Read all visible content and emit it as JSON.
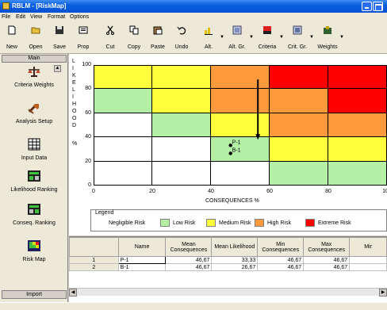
{
  "window": {
    "title": "RBLM - [RiskMap]"
  },
  "menu": [
    "File",
    "Edit",
    "View",
    "Format",
    "Options"
  ],
  "toolbar": [
    {
      "label": "New",
      "icon": "new-document-icon"
    },
    {
      "label": "Open",
      "icon": "open-folder-icon"
    },
    {
      "label": "Save",
      "icon": "save-disk-icon"
    },
    {
      "label": "Prop",
      "icon": "properties-icon"
    },
    {
      "label": "Cut",
      "icon": "scissors-icon"
    },
    {
      "label": "Copy",
      "icon": "copy-icon"
    },
    {
      "label": "Paste",
      "icon": "paste-icon"
    },
    {
      "label": "Undo",
      "icon": "undo-icon"
    },
    {
      "label": "Alt.",
      "icon": "alternatives-icon"
    },
    {
      "label": "Alt. Gr.",
      "icon": "alternative-groups-icon"
    },
    {
      "label": "Criteria",
      "icon": "criteria-icon"
    },
    {
      "label": "Crit. Gr.",
      "icon": "criteria-groups-icon"
    },
    {
      "label": "Weights",
      "icon": "weights-icon"
    }
  ],
  "sidebar": {
    "header": "Main",
    "footer": "Import",
    "items": [
      {
        "label": "Criteria Weights",
        "icon": "scales-icon"
      },
      {
        "label": "Analysis Setup",
        "icon": "tools-icon"
      },
      {
        "label": "Input Data",
        "icon": "data-grid-icon"
      },
      {
        "label": "Likelihood Ranking",
        "icon": "likelihood-ranking-icon"
      },
      {
        "label": "Conseq. Ranking",
        "icon": "consequence-ranking-icon"
      },
      {
        "label": "Risk Map",
        "icon": "risk-map-icon"
      }
    ]
  },
  "risk_map": {
    "y_axis_letters": [
      "L",
      "I",
      "K",
      "E",
      "L",
      "I",
      "H",
      "O",
      "O",
      "D"
    ],
    "y_unit": "%",
    "x_label": "CONSEQUENCES %",
    "y_ticks": [
      "100",
      "80",
      "60",
      "40",
      "20",
      "0"
    ],
    "x_ticks": [
      "0",
      "20",
      "40",
      "60",
      "80",
      "100"
    ],
    "colors": {
      "negligible": "#ffffff",
      "low": "#b3f0a6",
      "medium": "#ffff3c",
      "high": "#ff9a3c",
      "extreme": "#ff0000"
    },
    "cells": [
      [
        "medium",
        "medium",
        "high",
        "extreme",
        "extreme"
      ],
      [
        "low",
        "medium",
        "high",
        "high",
        "extreme"
      ],
      [
        "negligible",
        "low",
        "medium",
        "high",
        "high"
      ],
      [
        "negligible",
        "negligible",
        "low",
        "medium",
        "medium"
      ],
      [
        "negligible",
        "negligible",
        "negligible",
        "low",
        "low"
      ]
    ],
    "points": [
      {
        "label": "P-1",
        "x": 46.67,
        "y": 33.33
      },
      {
        "label": "B-1",
        "x": 46.67,
        "y": 26.67
      }
    ],
    "arrow": {
      "x": 56,
      "y_from": 88,
      "y_to": 38
    },
    "legend": {
      "title": "Legend",
      "entries": [
        {
          "label": "Negligible Risk",
          "key": "negligible"
        },
        {
          "label": "Low Risk",
          "key": "low"
        },
        {
          "label": "Medium Risk",
          "key": "medium"
        },
        {
          "label": "High Risk",
          "key": "high"
        },
        {
          "label": "Extreme Risk",
          "key": "extreme"
        }
      ]
    }
  },
  "table": {
    "columns": [
      "Name",
      "Mean Consequences",
      "Mean Likelihood",
      "Min Consequences",
      "Max Consequences",
      "Mir"
    ],
    "rows": [
      {
        "n": "1",
        "name": "P-1",
        "mean_c": "46,67",
        "mean_l": "33,33",
        "min_c": "46,67",
        "max_c": "46,67"
      },
      {
        "n": "2",
        "name": "B-1",
        "mean_c": "46,67",
        "mean_l": "26,67",
        "min_c": "46,67",
        "max_c": "46,67"
      }
    ]
  }
}
